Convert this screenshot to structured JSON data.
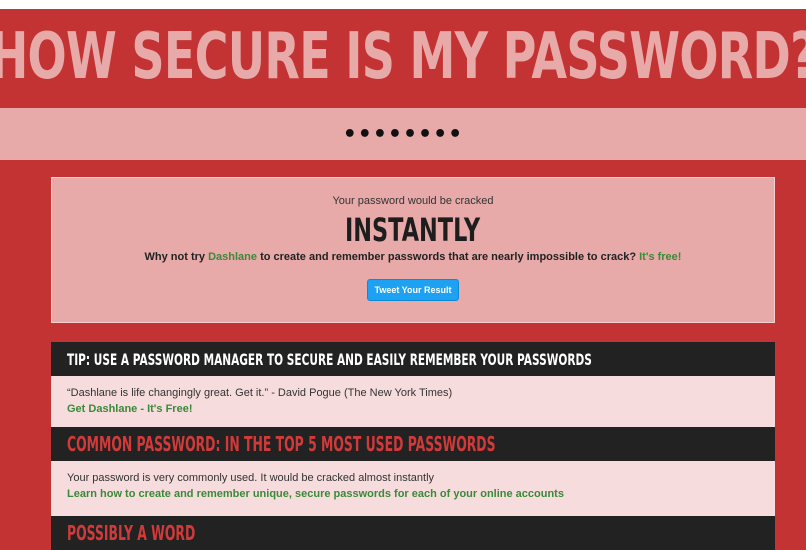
{
  "header": {
    "title": "HOW SECURE IS MY PASSWORD?"
  },
  "password": {
    "value": "••••••••"
  },
  "result": {
    "intro": "Your password would be cracked",
    "time": "INSTANTLY",
    "pitch_pre": "Why not try ",
    "pitch_brand": "Dashlane",
    "pitch_mid": " to create and remember passwords that are nearly impossible to crack? ",
    "pitch_free": "It's free!",
    "tweet_label": "Tweet Your Result"
  },
  "sections": [
    {
      "heading": "TIP: USE A PASSWORD MANAGER TO SECURE AND EASILY REMEMBER YOUR PASSWORDS",
      "heading_color": "#ffffff",
      "text": "“Dashlane is life changingly great. Get it.” - David Pogue (The New York Times)",
      "link": "Get Dashlane - It's Free!"
    },
    {
      "heading": "COMMON PASSWORD: IN THE TOP 5 MOST USED PASSWORDS",
      "heading_color": "#d23a3a",
      "text": "Your password is very commonly used. It would be cracked almost instantly",
      "link": "Learn how to create and remember unique, secure passwords for each of your online accounts"
    },
    {
      "heading": "POSSIBLY A WORD",
      "heading_color": "#d23a3a"
    }
  ],
  "colors": {
    "background": "#c33333",
    "title": "#e8a9a9",
    "accent_green": "#3a8a3a",
    "tweet_blue": "#1da1f2"
  }
}
